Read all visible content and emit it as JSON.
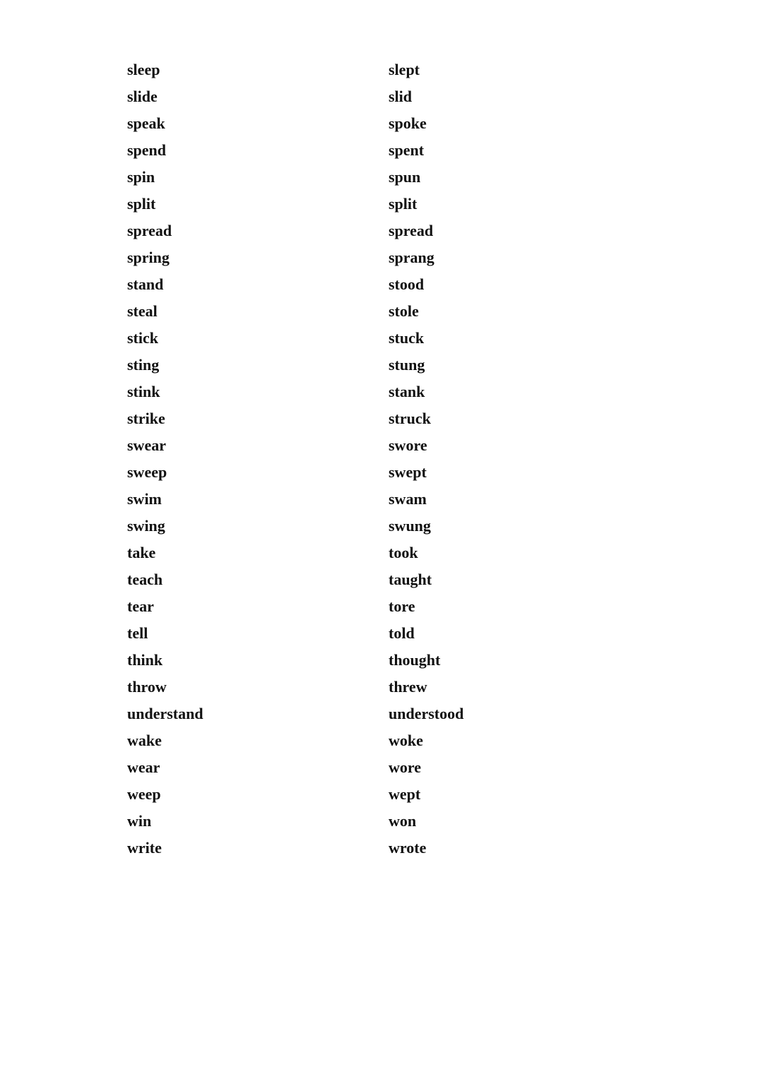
{
  "words": [
    {
      "base": "sleep",
      "past": "slept"
    },
    {
      "base": "slide",
      "past": "slid"
    },
    {
      "base": "speak",
      "past": "spoke"
    },
    {
      "base": "spend",
      "past": "spent"
    },
    {
      "base": "spin",
      "past": "spun"
    },
    {
      "base": "split",
      "past": "split"
    },
    {
      "base": "spread",
      "past": "spread"
    },
    {
      "base": "spring",
      "past": "sprang"
    },
    {
      "base": "stand",
      "past": "stood"
    },
    {
      "base": "steal",
      "past": "stole"
    },
    {
      "base": "stick",
      "past": "stuck"
    },
    {
      "base": "sting",
      "past": "stung"
    },
    {
      "base": "stink",
      "past": "stank"
    },
    {
      "base": "strike",
      "past": "struck"
    },
    {
      "base": "swear",
      "past": "swore"
    },
    {
      "base": "sweep",
      "past": "swept"
    },
    {
      "base": "swim",
      "past": "swam"
    },
    {
      "base": "swing",
      "past": "swung"
    },
    {
      "base": "take",
      "past": "took"
    },
    {
      "base": "teach",
      "past": "taught"
    },
    {
      "base": "tear",
      "past": "tore"
    },
    {
      "base": "tell",
      "past": "told"
    },
    {
      "base": "think",
      "past": "thought"
    },
    {
      "base": "throw",
      "past": "threw"
    },
    {
      "base": "understand",
      "past": "understood"
    },
    {
      "base": "wake",
      "past": "woke"
    },
    {
      "base": "wear",
      "past": "wore"
    },
    {
      "base": "weep",
      "past": "wept"
    },
    {
      "base": "win",
      "past": "won"
    },
    {
      "base": "write",
      "past": "wrote"
    }
  ]
}
